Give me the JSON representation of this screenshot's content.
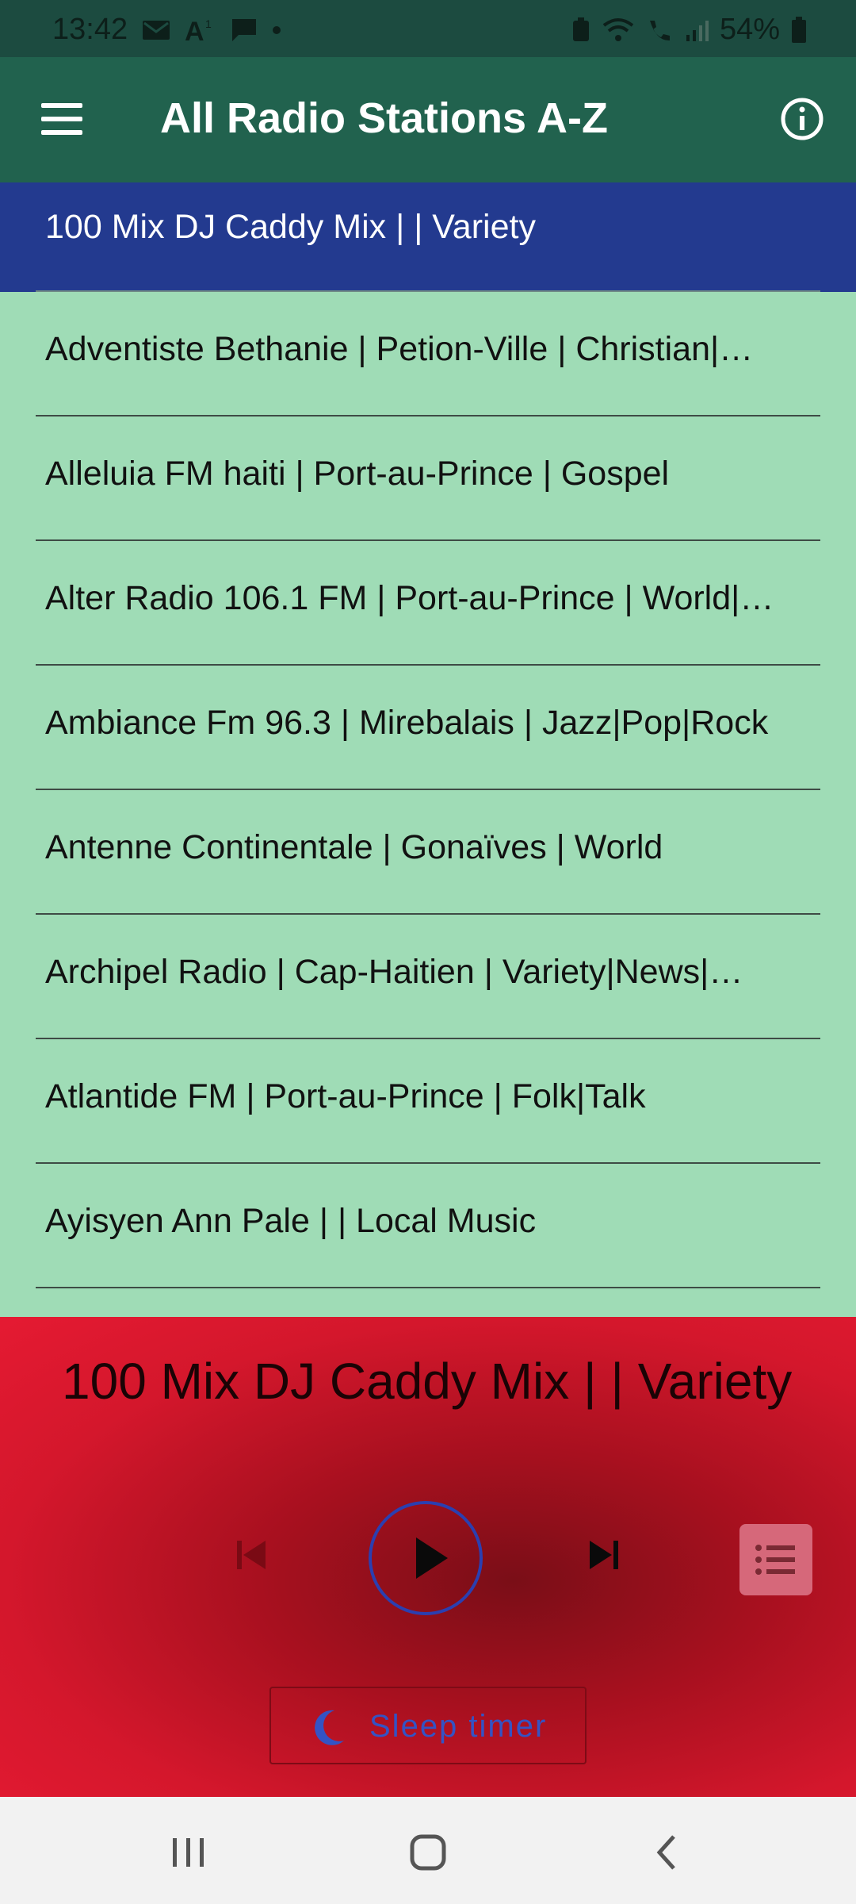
{
  "status_bar": {
    "time": "13:42",
    "battery": "54%"
  },
  "app_bar": {
    "title": "All Radio Stations A-Z",
    "menu_icon": "hamburger-menu-icon",
    "info_icon": "info-icon"
  },
  "stations": [
    {
      "label": "100 Mix DJ Caddy Mix | | Variety",
      "selected": true
    },
    {
      "label": "Adventiste Bethanie | Petion-Ville | Christian|…",
      "selected": false
    },
    {
      "label": "Alleluia FM haiti | Port-au-Prince | Gospel",
      "selected": false
    },
    {
      "label": "Alter Radio 106.1 FM | Port-au-Prince | World|…",
      "selected": false
    },
    {
      "label": "Ambiance Fm 96.3 | Mirebalais | Jazz|Pop|Rock",
      "selected": false
    },
    {
      "label": "Antenne Continentale | Gonaïves | World",
      "selected": false
    },
    {
      "label": "Archipel Radio | Cap-Haitien | Variety|News|…",
      "selected": false
    },
    {
      "label": "Atlantide FM | Port-au-Prince | Folk|Talk",
      "selected": false
    },
    {
      "label": "Ayisyen Ann Pale | | Local Music",
      "selected": false
    }
  ],
  "player": {
    "now_playing": "100 Mix DJ Caddy Mix | | Variety",
    "sleep_timer_label": "Sleep timer"
  },
  "colors": {
    "status_bar": "#1c4b40",
    "app_bar": "#21624e",
    "list_bg": "#9fdcb6",
    "selected_row": "#233a8f",
    "player_red": "#d4172c",
    "accent_blue": "#2b3fb0"
  }
}
